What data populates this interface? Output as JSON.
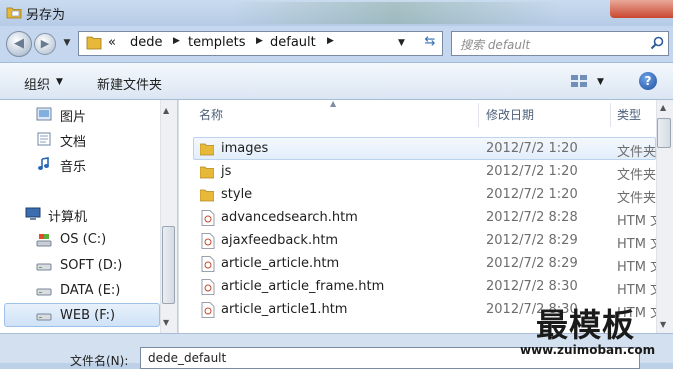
{
  "window": {
    "title": "另存为"
  },
  "address": {
    "crumbs": [
      "«",
      "dede",
      "templets",
      "default"
    ],
    "search_placeholder": "搜索 default"
  },
  "toolbar": {
    "organize_label": "组织",
    "new_folder_label": "新建文件夹"
  },
  "nav_pane": {
    "favorites": [
      {
        "label": "图片",
        "icon": "pictures-icon"
      },
      {
        "label": "文档",
        "icon": "documents-icon"
      },
      {
        "label": "音乐",
        "icon": "music-icon"
      }
    ],
    "computer": {
      "label": "计算机",
      "icon": "computer-icon"
    },
    "drives": [
      {
        "label": "OS (C:)",
        "icon": "os-drive-icon"
      },
      {
        "label": "SOFT (D:)",
        "icon": "drive-icon"
      },
      {
        "label": "DATA (E:)",
        "icon": "drive-icon"
      },
      {
        "label": "WEB (F:)",
        "icon": "drive-icon",
        "selected": true
      }
    ]
  },
  "file_list": {
    "columns": {
      "name": "名称",
      "date": "修改日期",
      "type": "类型"
    },
    "rows": [
      {
        "name": "images",
        "date": "2012/7/2 1:20",
        "type": "文件夹",
        "kind": "folder"
      },
      {
        "name": "js",
        "date": "2012/7/2 1:20",
        "type": "文件夹",
        "kind": "folder"
      },
      {
        "name": "style",
        "date": "2012/7/2 1:20",
        "type": "文件夹",
        "kind": "folder"
      },
      {
        "name": "advancedsearch.htm",
        "date": "2012/7/2 8:28",
        "type": "HTM 文",
        "kind": "file"
      },
      {
        "name": "ajaxfeedback.htm",
        "date": "2012/7/2 8:29",
        "type": "HTM 文",
        "kind": "file"
      },
      {
        "name": "article_article.htm",
        "date": "2012/7/2 8:29",
        "type": "HTM 文",
        "kind": "file"
      },
      {
        "name": "article_article_frame.htm",
        "date": "2012/7/2 8:30",
        "type": "HTM 文",
        "kind": "file"
      },
      {
        "name": "article_article1.htm",
        "date": "2012/7/2 8:30",
        "type": "HTM 文",
        "kind": "file"
      }
    ]
  },
  "filename": {
    "label": "文件名(N):",
    "value": "dede_default"
  },
  "watermark": {
    "main": "最模板",
    "url": "www.zuimoban.com"
  },
  "colors": {
    "folder": "#e8b838",
    "accent": "#2d6db5"
  }
}
